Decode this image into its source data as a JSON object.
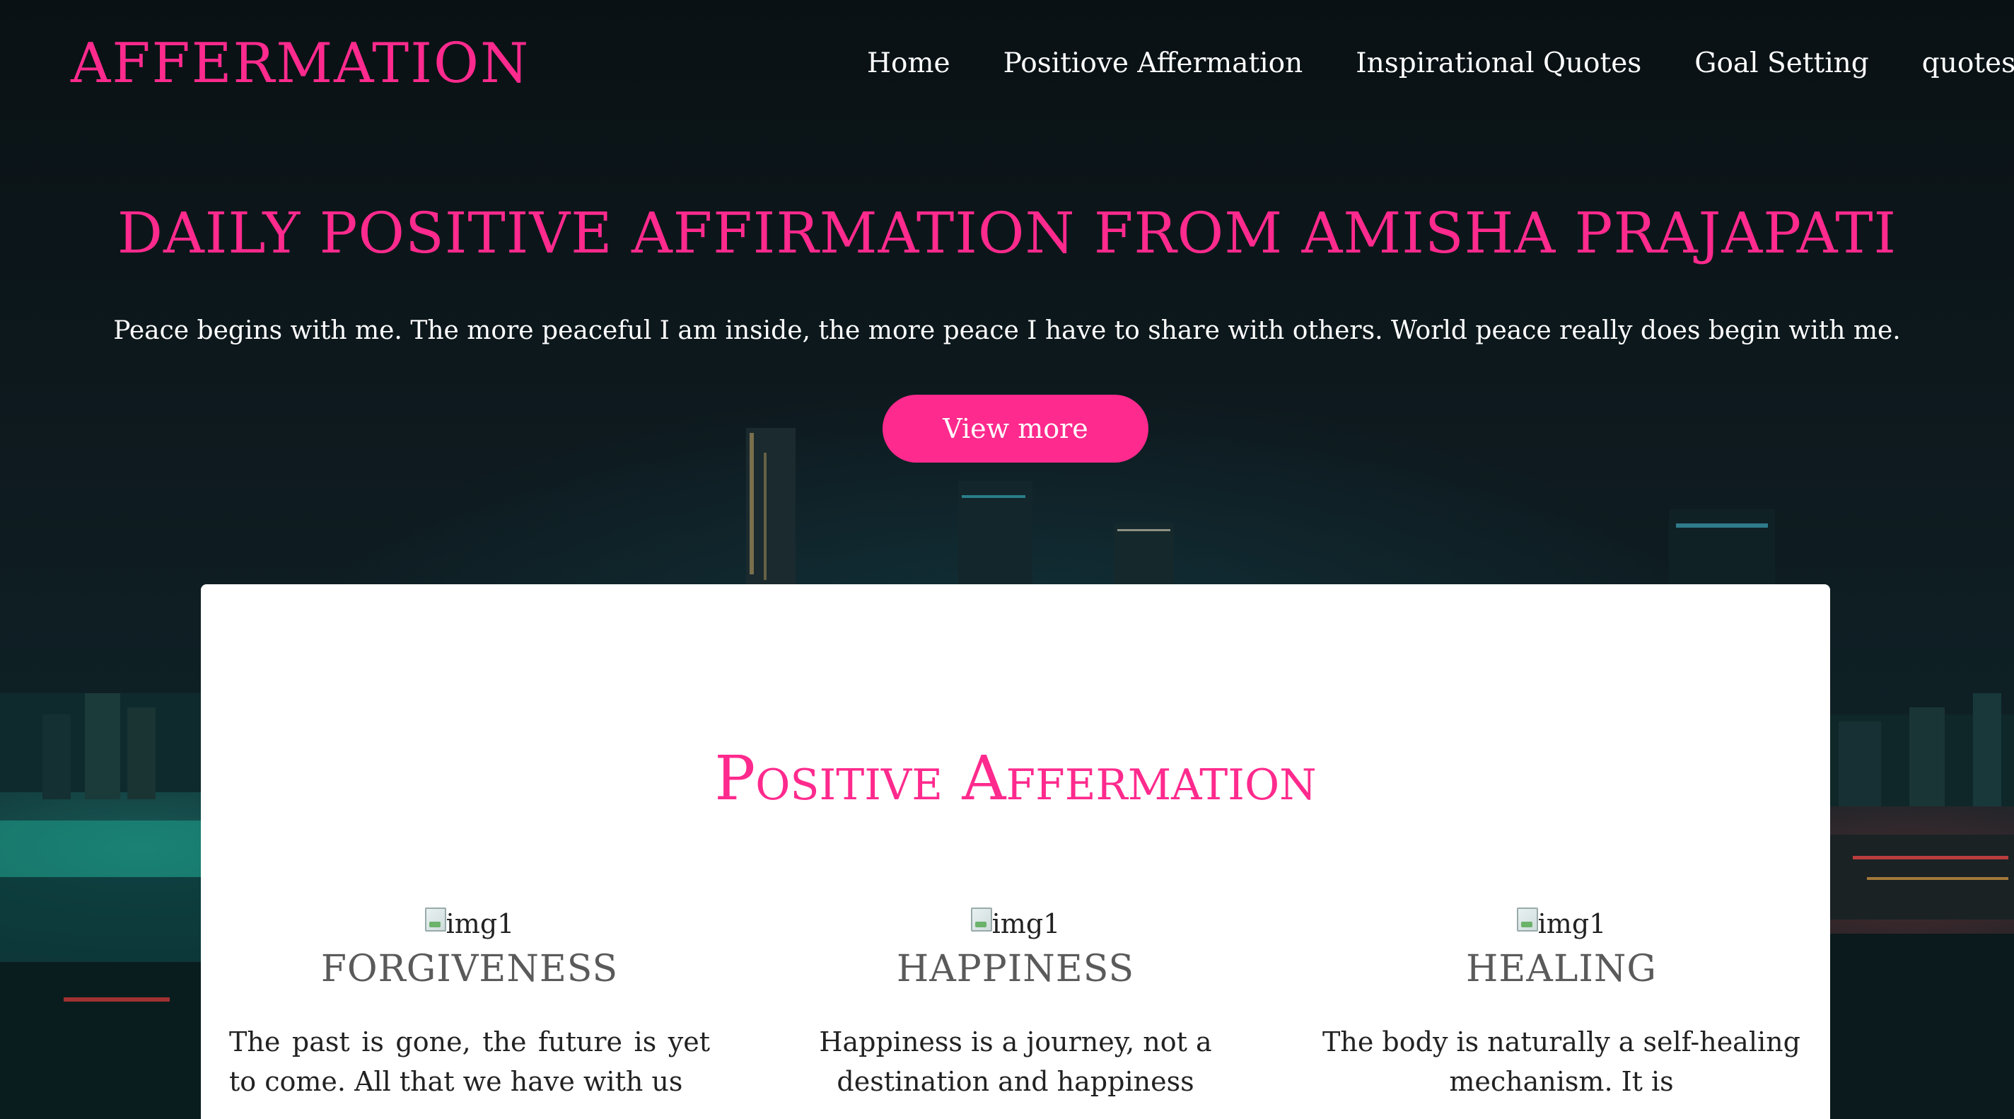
{
  "navbar": {
    "brand": "AFFERMATION",
    "links": [
      {
        "label": "Home"
      },
      {
        "label": "Positiove Affermation"
      },
      {
        "label": "Inspirational Quotes"
      },
      {
        "label": "Goal Setting"
      },
      {
        "label": "quotes"
      }
    ]
  },
  "hero": {
    "title": "DAILY POSITIVE AFFIRMATION FROM AMISHA PRAJAPATI",
    "text": "Peace begins with me. The more peaceful I am inside, the more peace I have to share with others. World peace really does begin with me.",
    "button_label": "View more"
  },
  "section": {
    "title": "Positive Affermation",
    "features": [
      {
        "img_alt": "img1",
        "heading": "FORGIVENESS",
        "text": "The past is gone, the future is yet to come. All that we have with us"
      },
      {
        "img_alt": "img1",
        "heading": "HAPPINESS",
        "text": "Happiness is a journey, not a destination and happiness"
      },
      {
        "img_alt": "img1",
        "heading": "HEALING",
        "text": "The body is naturally a self-healing mechanism. It is"
      }
    ]
  },
  "colors": {
    "accent": "#ff2a8d",
    "heading_gray": "#5a5a5a",
    "card_bg": "#ffffff"
  }
}
